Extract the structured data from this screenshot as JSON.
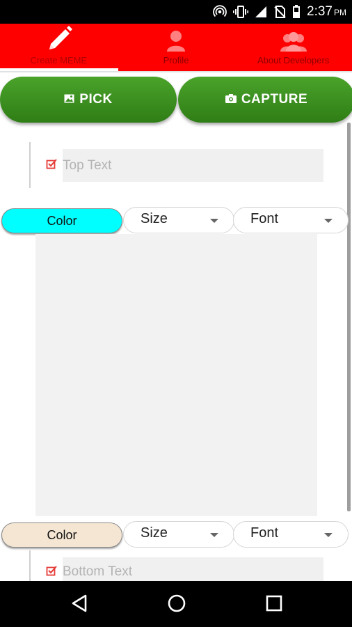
{
  "status_bar": {
    "time": "2:37",
    "ampm": "PM",
    "icons": [
      "hotspot-icon",
      "vibrate-icon",
      "signal-icon",
      "no-sim-icon",
      "battery-icon"
    ]
  },
  "tabs": [
    {
      "label": "Create MEME",
      "icon": "pencil-icon",
      "active": true
    },
    {
      "label": "Profile",
      "icon": "person-icon",
      "active": false
    },
    {
      "label": "About Developers",
      "icon": "group-icon",
      "active": false
    }
  ],
  "buttons": {
    "pick_label": "PICK",
    "capture_label": "CAPTURE"
  },
  "top_text": {
    "placeholder": "Top Text",
    "value": ""
  },
  "top_controls": {
    "color_label": "Color",
    "color_value": "#00ffff",
    "size_label": "Size",
    "font_label": "Font"
  },
  "bottom_controls": {
    "color_label": "Color",
    "color_value": "#f5e6d3",
    "size_label": "Size",
    "font_label": "Font"
  },
  "bottom_text": {
    "placeholder": "Bottom Text",
    "value": ""
  },
  "colors": {
    "tab_bar": "#ff0000",
    "button_green": "#3a8f1e",
    "checkbox_red": "#e53935"
  },
  "nav": [
    "back-icon",
    "home-icon",
    "recents-icon"
  ]
}
